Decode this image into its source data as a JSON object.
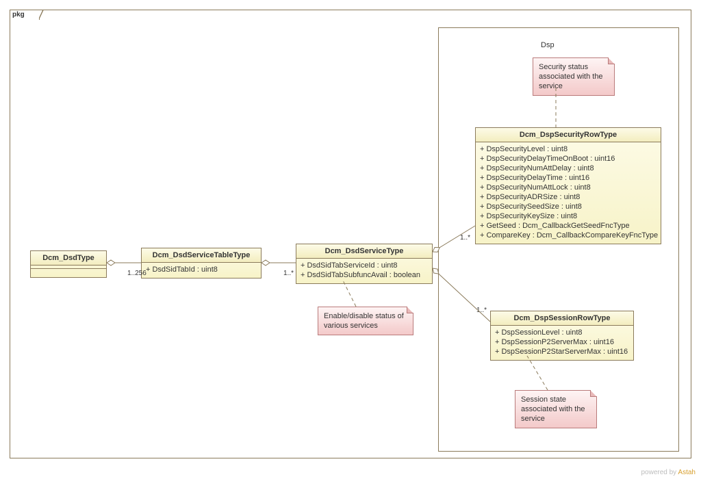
{
  "frame": {
    "pkg_label": "pkg",
    "dsp_label": "Dsp"
  },
  "classes": {
    "dsd_type": {
      "name": "Dcm_DsdType"
    },
    "service_table": {
      "name": "Dcm_DsdServiceTableType",
      "attrs": [
        "+ DsdSidTabId : uint8"
      ]
    },
    "service": {
      "name": "Dcm_DsdServiceType",
      "attrs": [
        "+ DsdSidTabServiceId : uint8",
        "+ DsdSidTabSubfuncAvail : boolean"
      ]
    },
    "sec_row": {
      "name": "Dcm_DspSecurityRowType",
      "attrs": [
        "+ DspSecurityLevel : uint8",
        "+ DspSecurityDelayTimeOnBoot : uint16",
        "+ DspSecurityNumAttDelay : uint8",
        "+ DspSecurityDelayTime : uint16",
        "+ DspSecurityNumAttLock : uint8",
        "+ DspSecurityADRSize : uint8",
        "+ DspSecuritySeedSize : uint8",
        "+ DspSecurityKeySize : uint8",
        "+ GetSeed : Dcm_CallbackGetSeedFncType",
        "+ CompareKey : Dcm_CallbackCompareKeyFncType"
      ]
    },
    "sess_row": {
      "name": "Dcm_DspSessionRowType",
      "attrs": [
        "+ DspSessionLevel : uint8",
        "+ DspSessionP2ServerMax : uint16",
        "+ DspSessionP2StarServerMax : uint16"
      ]
    }
  },
  "notes": {
    "security": "Security status associated with the service",
    "services": "Enable/disable status of various services",
    "session": "Session state associated with the service"
  },
  "mult": {
    "dsd_to_table": "1..256",
    "table_to_service": "1..*",
    "service_to_secrow": "1..*",
    "service_to_sessrow": "1..*"
  },
  "footer": {
    "powered_by": "powered by ",
    "brand": "Astah"
  }
}
